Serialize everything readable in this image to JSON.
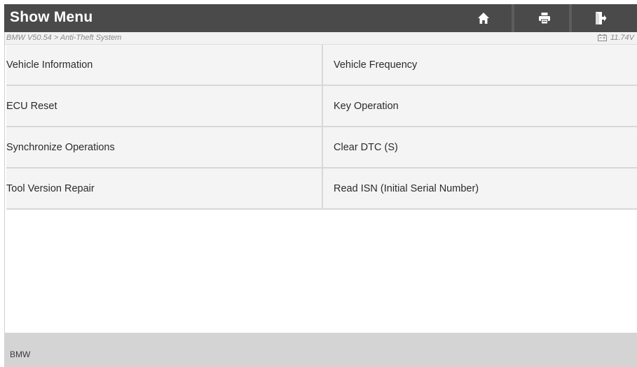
{
  "header": {
    "title": "Show Menu",
    "buttons": [
      {
        "name": "home",
        "icon": "home-icon"
      },
      {
        "name": "print",
        "icon": "printer-icon"
      },
      {
        "name": "exit",
        "icon": "exit-icon"
      }
    ]
  },
  "breadcrumb": {
    "path": "BMW V50.54 > Anti-Theft System",
    "voltage": "11.74V",
    "voltage_icon": "battery-icon"
  },
  "menu": {
    "rows": [
      {
        "left": "Vehicle Information",
        "right": "Vehicle Frequency"
      },
      {
        "left": "ECU Reset",
        "right": "Key Operation"
      },
      {
        "left": "Synchronize Operations",
        "right": "Clear DTC (S)"
      },
      {
        "left": "Tool Version Repair",
        "right": "Read ISN (Initial Serial Number)"
      }
    ]
  },
  "footer": {
    "vehicle": "BMW"
  },
  "colors": {
    "titlebar_bg": "#4a4a4a",
    "footer_bg": "#d4d4d4",
    "cell_bg": "#f4f4f4"
  }
}
